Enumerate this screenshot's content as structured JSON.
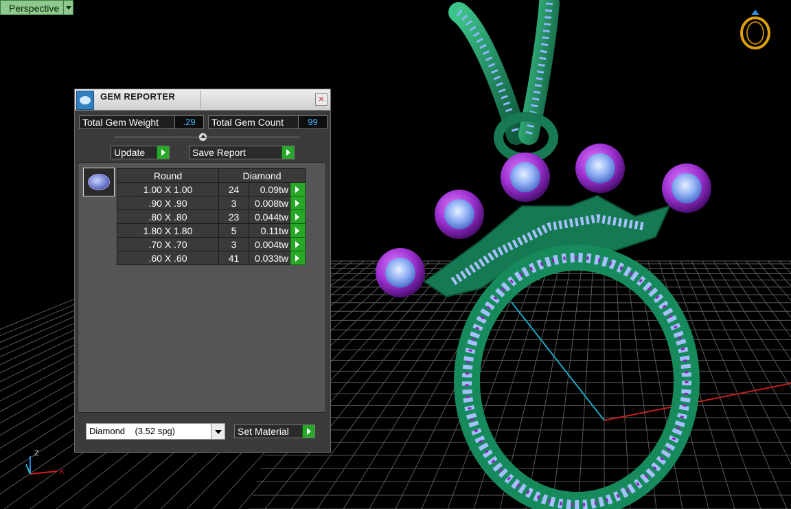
{
  "viewport": {
    "label": "Perspective",
    "axes": {
      "z": "Z",
      "x": "X"
    }
  },
  "gem_reporter": {
    "title": "GEM REPORTER",
    "close_label": "×",
    "total_gem_weight_label": "Total Gem Weight",
    "total_gem_weight_value": ".29",
    "total_gem_count_label": "Total Gem Count",
    "total_gem_count_value": "99",
    "update_label": "Update",
    "save_report_label": "Save Report",
    "table": {
      "headers": {
        "shape": "Round",
        "material": "Diamond"
      },
      "rows": [
        {
          "size": "1.00 X 1.00",
          "count": "24",
          "weight": "0.09tw"
        },
        {
          "size": ".90 X .90",
          "count": "3",
          "weight": "0.008tw"
        },
        {
          "size": ".80 X .80",
          "count": "23",
          "weight": "0.044tw"
        },
        {
          "size": "1.80 X 1.80",
          "count": "5",
          "weight": "0.11tw"
        },
        {
          "size": ".70 X .70",
          "count": "3",
          "weight": "0.004tw"
        },
        {
          "size": ".60 X .60",
          "count": "41",
          "weight": "0.033tw"
        }
      ]
    },
    "material_value": "Diamond    (3.52 spg)",
    "set_material_label": "Set Material"
  },
  "colors": {
    "metal": "#1f8a5f",
    "stone": "#9bb6ff",
    "accent_stone": "#8a2bb8",
    "button_go": "#27a827",
    "value_text": "#3fb6ff"
  },
  "icons": [
    "app-icon",
    "close-icon",
    "play-arrow-icon",
    "dropdown-arrow-icon",
    "ring-navigator-icon",
    "axis-gizmo-icon"
  ]
}
